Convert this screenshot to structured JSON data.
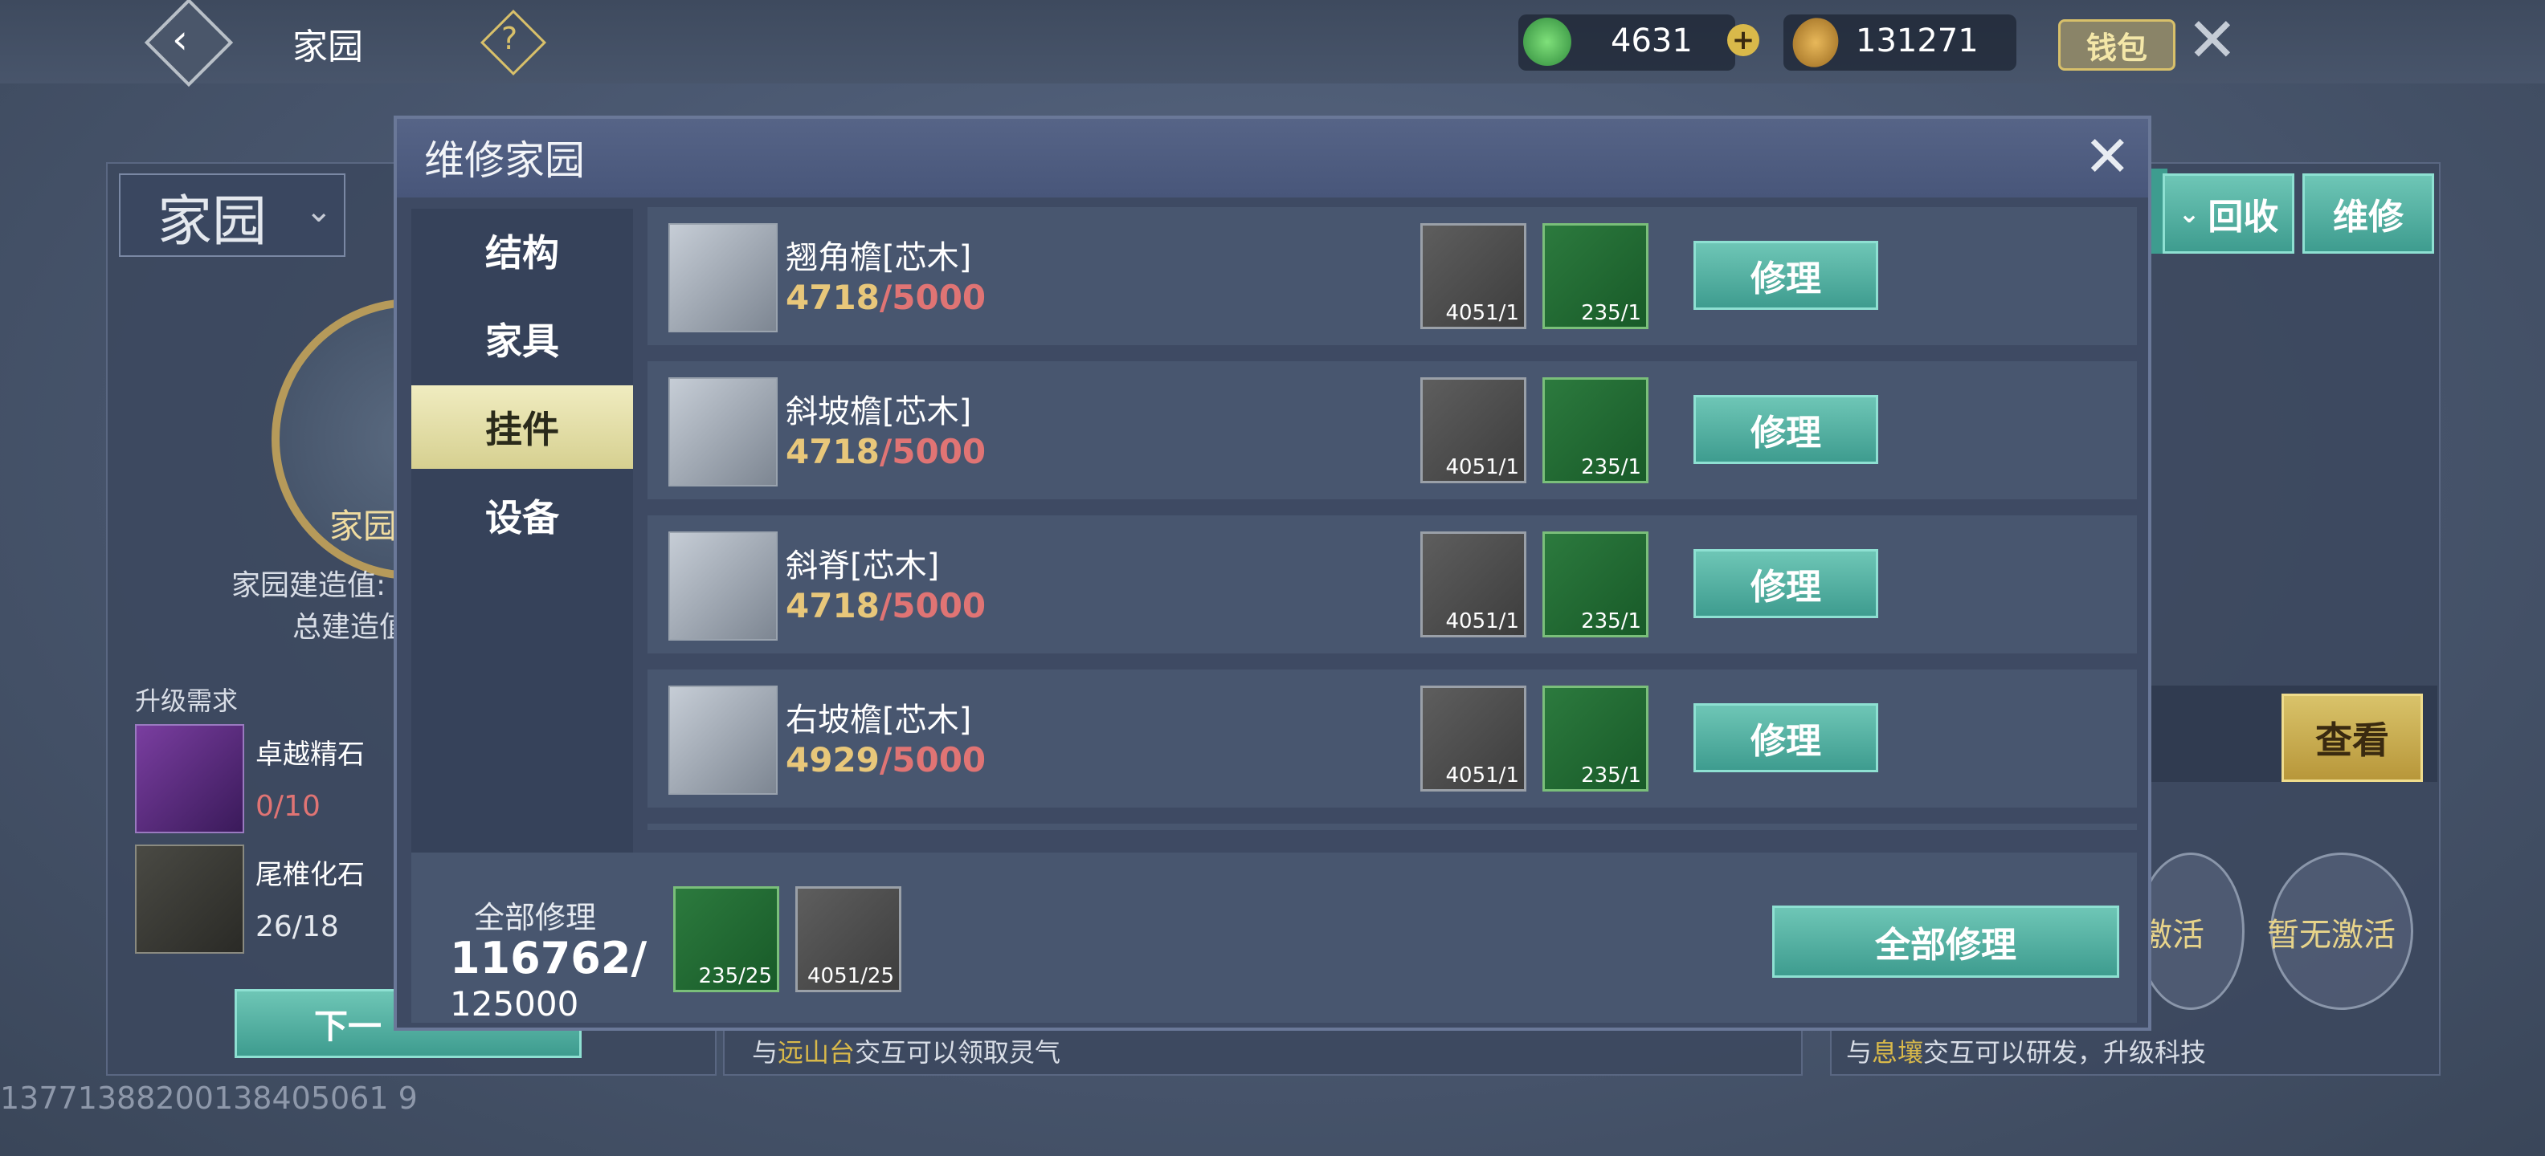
{
  "topbar": {
    "title": "家园",
    "jade_value": "4631",
    "coin_value": "131271",
    "wallet_label": "钱包"
  },
  "background": {
    "home_select": "家园",
    "recycle_label": "回收",
    "repair_label": "维修",
    "emblem_label": "家园",
    "build_value_label": "家园建造值:",
    "total_build_label": "总建造值",
    "upgrade_req_label": "升级需求",
    "req_items": [
      {
        "name": "卓越精石",
        "count": "0/10"
      },
      {
        "name": "尾椎化石",
        "count": "26/18"
      }
    ],
    "next_button": "下一",
    "view_label": "查看",
    "inactive_1": "激活",
    "inactive_2": "暂无激活",
    "hint_left_prefix": "与",
    "hint_left_place": "远山台",
    "hint_left_suffix": "交互可以领取灵气",
    "hint_right_prefix": "与",
    "hint_right_place": "息壤",
    "hint_right_suffix": "交互可以研发，升级科技",
    "footer_id": "13771388200138405061 9"
  },
  "modal": {
    "title": "维修家园",
    "tabs": [
      "结构",
      "家具",
      "挂件",
      "设备"
    ],
    "active_tab": 2,
    "repair_button": "修理",
    "items": [
      {
        "name": "翘角檐[芯木]",
        "cur": "4718",
        "max": "/5000",
        "mat1": "4051/1",
        "mat2": "235/1"
      },
      {
        "name": "斜坡檐[芯木]",
        "cur": "4718",
        "max": "/5000",
        "mat1": "4051/1",
        "mat2": "235/1"
      },
      {
        "name": "斜脊[芯木]",
        "cur": "4718",
        "max": "/5000",
        "mat1": "4051/1",
        "mat2": "235/1"
      },
      {
        "name": "右坡檐[芯木]",
        "cur": "4929",
        "max": "/5000",
        "mat1": "4051/1",
        "mat2": "235/1"
      }
    ],
    "footer": {
      "label": "全部修理",
      "total_cur": "116762/",
      "total_max": "125000",
      "mat_log": "235/25",
      "mat_wood": "4051/25",
      "button": "全部修理"
    }
  },
  "icons": {
    "back": "back-arrow-icon",
    "help": "help-question-icon",
    "jade": "jade-currency-icon",
    "add": "add-plus-icon",
    "coin": "coin-currency-icon",
    "close": "close-x-icon"
  }
}
